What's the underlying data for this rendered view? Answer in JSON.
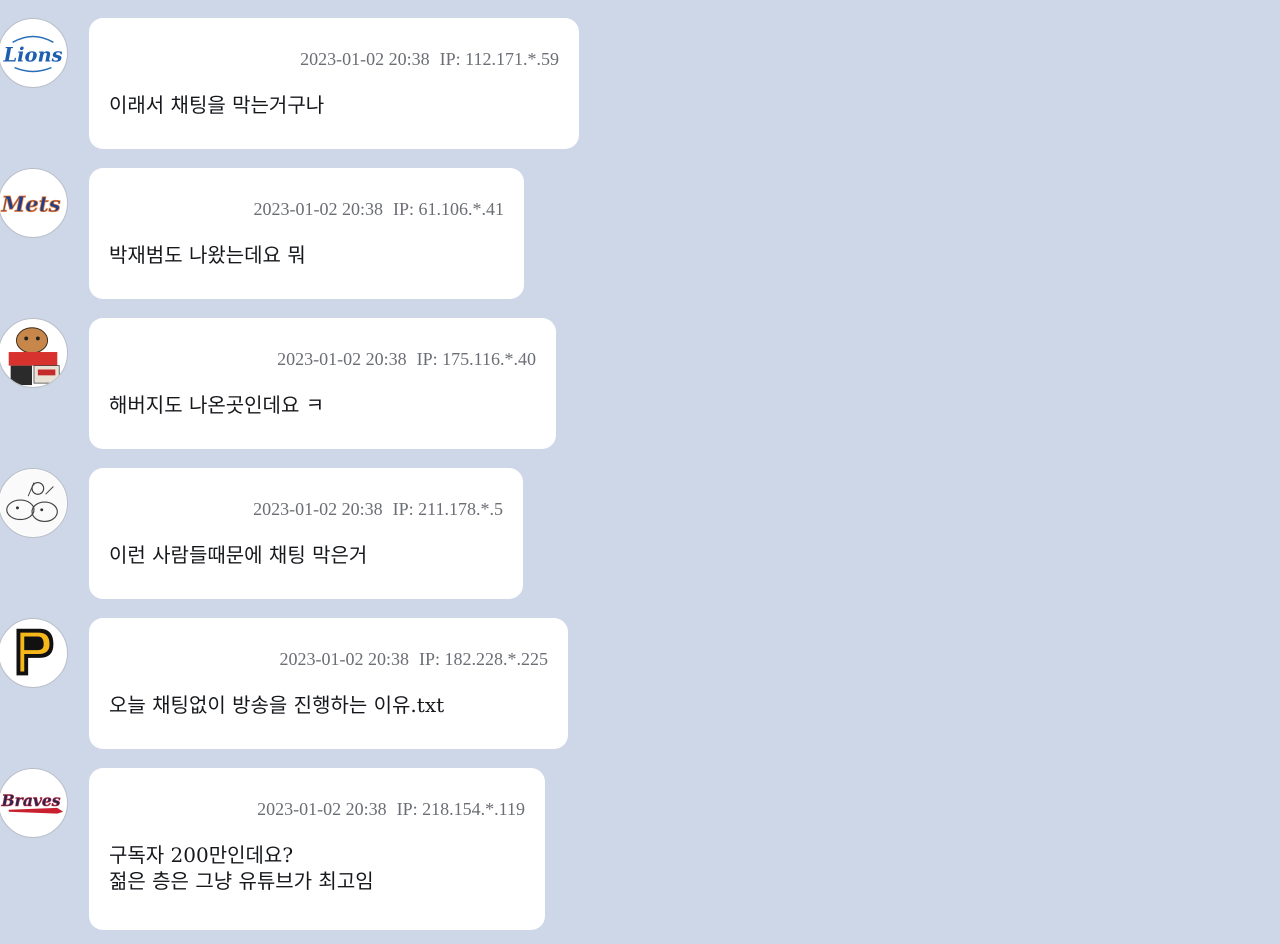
{
  "messages": [
    {
      "avatar": "lions-logo-icon",
      "timestamp": "2023-01-02 20:38",
      "ip": "IP: 112.171.*.59",
      "text": "이래서 채팅을 막는거구나"
    },
    {
      "avatar": "mets-logo-icon",
      "timestamp": "2023-01-02 20:38",
      "ip": "IP: 61.106.*.41",
      "text": "박재범도 나왔는데요 뭐"
    },
    {
      "avatar": "tiger-mascot-icon",
      "timestamp": "2023-01-02 20:38",
      "ip": "IP: 175.116.*.40",
      "text": "해버지도 나온곳인데요 ㅋ"
    },
    {
      "avatar": "cartoon-sketch-icon",
      "timestamp": "2023-01-02 20:38",
      "ip": "IP: 211.178.*.5",
      "text": "이런 사람들때문에 채팅 막은거"
    },
    {
      "avatar": "pirates-p-logo-icon",
      "timestamp": "2023-01-02 20:38",
      "ip": "IP: 182.228.*.225",
      "text": "오늘 채팅없이 방송을 진행하는 이유.txt"
    },
    {
      "avatar": "braves-logo-icon",
      "timestamp": "2023-01-02 20:38",
      "ip": "IP: 218.154.*.119",
      "text_line1": "구독자 200만인데요?",
      "text_line2": "젊은 층은 그냥 유튜브가 최고임"
    }
  ],
  "colors": {
    "background": "#ced7e8",
    "bubble": "#ffffff",
    "meta_text": "#6b6e74",
    "body_text": "#16181c"
  }
}
